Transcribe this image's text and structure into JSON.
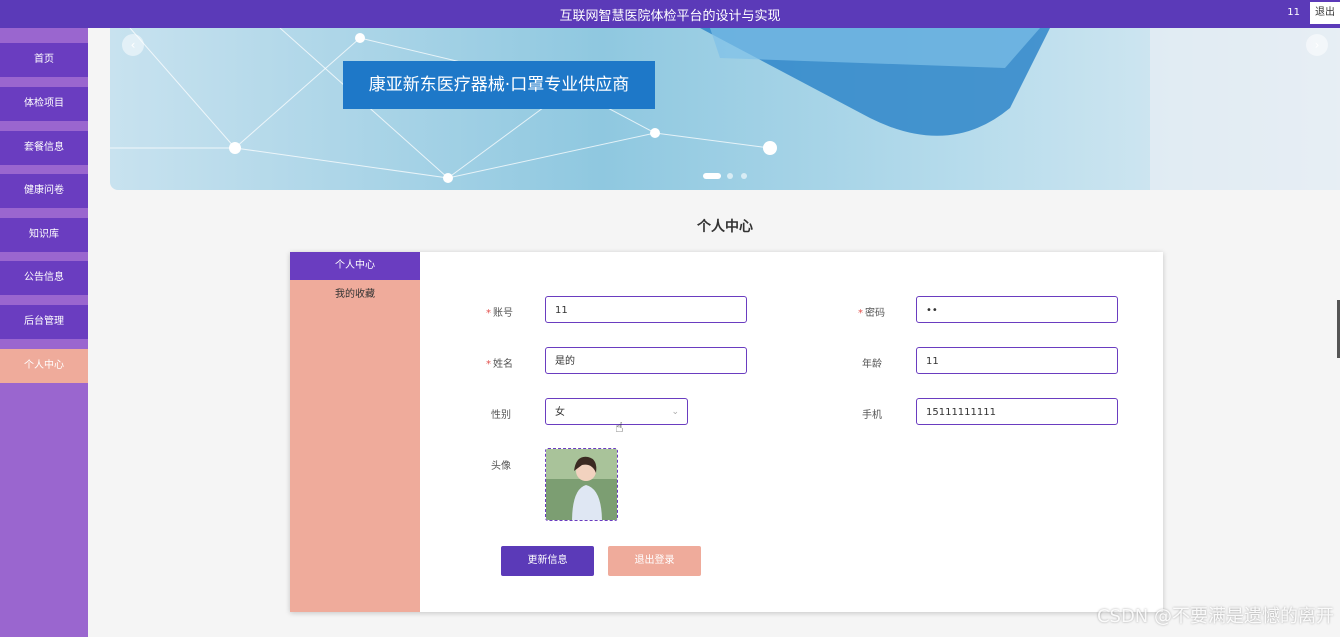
{
  "header": {
    "title": "互联网智慧医院体检平台的设计与实现",
    "user": "11",
    "logout_label": "退出"
  },
  "sidebar": {
    "items": [
      {
        "label": "首页"
      },
      {
        "label": "体检项目"
      },
      {
        "label": "套餐信息"
      },
      {
        "label": "健康问卷"
      },
      {
        "label": "知识库"
      },
      {
        "label": "公告信息"
      },
      {
        "label": "后台管理"
      },
      {
        "label": "个人中心"
      }
    ],
    "active": "个人中心"
  },
  "banner": {
    "caption": "康亚新东医疗器械·口罩专业供应商",
    "prev_icon": "chevron-left-icon",
    "next_icon": "chevron-right-icon"
  },
  "page": {
    "title": "个人中心"
  },
  "tabs": [
    {
      "label": "个人中心"
    },
    {
      "label": "我的收藏"
    }
  ],
  "form": {
    "account": {
      "label": "账号",
      "value": "11"
    },
    "password": {
      "label": "密码",
      "value": "••"
    },
    "name": {
      "label": "姓名",
      "value": "是的"
    },
    "age": {
      "label": "年龄",
      "value": "11"
    },
    "gender": {
      "label": "性别",
      "value": "女"
    },
    "phone": {
      "label": "手机",
      "value": "15111111111"
    },
    "avatar": {
      "label": "头像"
    }
  },
  "buttons": {
    "update": "更新信息",
    "logout": "退出登录"
  },
  "watermark": "CSDN @不要满是遗憾的离开",
  "colors": {
    "primary": "#5b3ab8",
    "accent": "#efab9b",
    "sidebar_bg": "#9a66cf"
  }
}
